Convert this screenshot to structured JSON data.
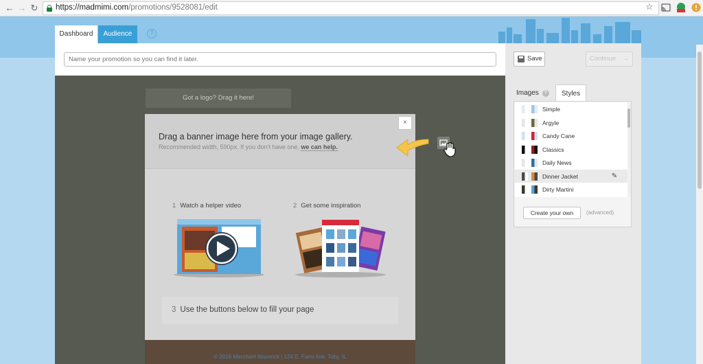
{
  "browser": {
    "url_host": "https://madmimi.com",
    "url_path": "/promotions/9528081/edit"
  },
  "editor": {
    "tabs": [
      {
        "label": "Dashboard",
        "active": true
      },
      {
        "label": "Audience",
        "active": false
      }
    ],
    "help_label": "?",
    "name_placeholder": "Name your promotion so you can find it later."
  },
  "canvas": {
    "logo_drop_label": "Got a logo? Drag it here!",
    "banner": {
      "title": "Drag a banner image here from your image gallery.",
      "subtitle": "Recommended width, 590px. If you don't have one, ",
      "help_link": "we can help.",
      "close_label": "×"
    },
    "steps": [
      {
        "num": "1",
        "label": "Watch a helper video"
      },
      {
        "num": "2",
        "label": "Get some inspiration"
      },
      {
        "num": "3",
        "label": "Use the buttons below to fill your page"
      }
    ],
    "footer_text": "© 2016 Merchant Maverick | 124 E. Farm Ave. Toby, IL"
  },
  "sidebar": {
    "save_label": "Save",
    "continue_label": "Continue",
    "tabs": [
      {
        "label": "Images",
        "badge": "?"
      },
      {
        "label": "Styles",
        "active": true
      }
    ],
    "styles": [
      {
        "name": "Simple",
        "colors": [
          "#e3ecf4",
          "#9fc6e8"
        ],
        "selected": false
      },
      {
        "name": "Argyle",
        "colors": [
          "#e6e6e6",
          "#6b6b3a"
        ],
        "selected": false
      },
      {
        "name": "Candy Cane",
        "colors": [
          "#cfe1f6",
          "#c8283a"
        ],
        "selected": false
      },
      {
        "name": "Classics",
        "colors": [
          "#111111",
          "#8b1f1f"
        ],
        "selected": false
      },
      {
        "name": "Daily News",
        "colors": [
          "#e6e6e6",
          "#2a6fa8"
        ],
        "selected": false
      },
      {
        "name": "Dinner Jacket",
        "colors": [
          "#4a4a4a",
          "#d58a3a"
        ],
        "selected": true
      },
      {
        "name": "Dirty Martini",
        "colors": [
          "#3a3a2a",
          "#5aa0d8"
        ],
        "selected": false
      }
    ],
    "create_label": "Create your own",
    "advanced_label": "(advanced)"
  }
}
